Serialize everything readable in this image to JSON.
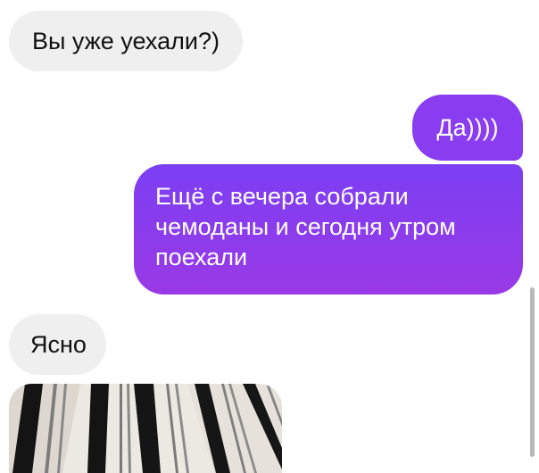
{
  "messages": [
    {
      "direction": "incoming",
      "text": "Вы уже уехали?)"
    },
    {
      "direction": "outgoing",
      "text": "Да))))"
    },
    {
      "direction": "outgoing",
      "text": "Ещё с вечера собрали чемоданы и сегодня утром поехали"
    },
    {
      "direction": "incoming",
      "text": "Ясно"
    }
  ],
  "photo_attachment": {
    "kind": "image",
    "description_icon": "striped-fabric-photo"
  },
  "colors": {
    "incoming_bubble": "#efefef",
    "outgoing_bubble_top": "#7b3ff2",
    "outgoing_bubble_bottom": "#9a39e6",
    "incoming_text": "#111111",
    "outgoing_text": "#ffffff"
  }
}
